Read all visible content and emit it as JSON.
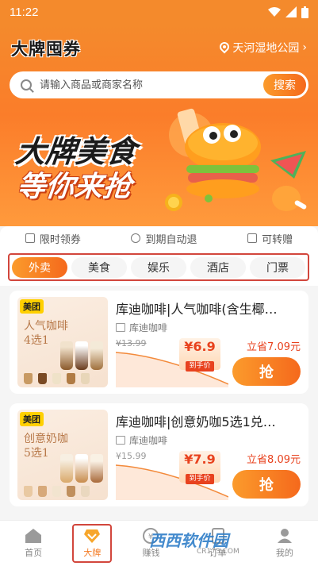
{
  "status_bar": {
    "time": "11:22"
  },
  "header": {
    "brand": "大牌囤券",
    "location": "天河湿地公园",
    "search_placeholder": "请输入商品或商家名称",
    "search_button": "搜索"
  },
  "banner": {
    "line1": "大牌美食",
    "line2": "等你来抢"
  },
  "benefits": [
    "限时领券",
    "到期自动退",
    "可转赠"
  ],
  "tabs": [
    "外卖",
    "美食",
    "娱乐",
    "酒店",
    "门票"
  ],
  "active_tab": "外卖",
  "products": [
    {
      "badge": "美团",
      "thumb_text": "人气咖啡\n4选1",
      "title": "库迪咖啡|人气咖啡(含生椰…",
      "merchant": "库迪咖啡",
      "original_price": "¥13.99",
      "deal_price": "¥6.9",
      "deal_label": "到手价",
      "save": "立省7.09元",
      "button": "抢"
    },
    {
      "badge": "美团",
      "thumb_text": "创意奶咖\n5选1",
      "title": "库迪咖啡|创意奶咖5选1兑…",
      "merchant": "库迪咖啡",
      "original_price": "¥15.99",
      "deal_price": "¥7.9",
      "deal_label": "到手价",
      "save": "立省8.09元",
      "button": "抢"
    }
  ],
  "bottom_nav": [
    {
      "label": "首页",
      "icon": "home-icon"
    },
    {
      "label": "大牌",
      "icon": "diamond-icon"
    },
    {
      "label": "赚钱",
      "icon": "coin-icon"
    },
    {
      "label": "订单",
      "icon": "order-icon"
    },
    {
      "label": "我的",
      "icon": "user-icon"
    }
  ],
  "watermark": {
    "text": "西西软件园",
    "sub": "CR173.COM"
  },
  "colors": {
    "primary": "#f5691c",
    "accent": "#fb9b2c",
    "highlight": "#d2463c",
    "price": "#e8421e"
  }
}
